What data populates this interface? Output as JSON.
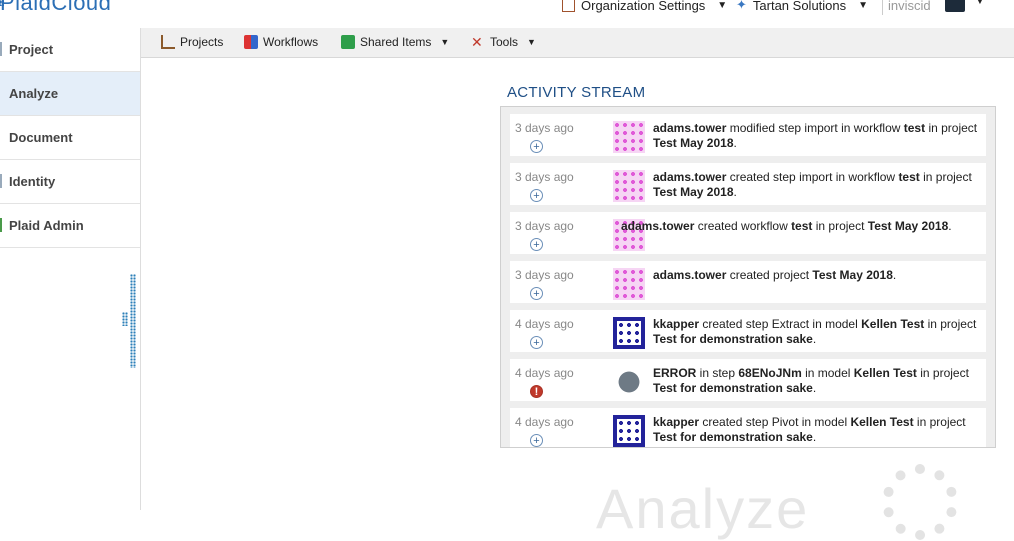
{
  "app": {
    "logo_text": "PlaidCloud"
  },
  "topnav": {
    "org_settings": "Organization Settings",
    "tartan": "Tartan Solutions",
    "user": "inviscid"
  },
  "sidebar": {
    "items": [
      {
        "label": "Project",
        "active": false
      },
      {
        "label": "Analyze",
        "active": true
      },
      {
        "label": "Document",
        "active": false
      },
      {
        "label": "Identity",
        "active": false
      },
      {
        "label": "Plaid Admin",
        "active": false
      }
    ]
  },
  "toolbar": {
    "projects": "Projects",
    "workflows": "Workflows",
    "shared_items": "Shared Items",
    "tools": "Tools"
  },
  "stream": {
    "title": "ACTIVITY STREAM",
    "entries": [
      {
        "time": "3 days ago",
        "icon": "plus-circle-icon"
      },
      {
        "time": "3 days ago",
        "icon": "plus-circle-icon"
      },
      {
        "time": "3 days ago",
        "icon": "plus-circle-icon"
      },
      {
        "time": "3 days ago",
        "icon": "plus-circle-icon"
      },
      {
        "time": "4 days ago",
        "icon": "plus-circle-icon"
      },
      {
        "time": "4 days ago",
        "icon": "error-icon"
      },
      {
        "time": "4 days ago",
        "icon": "plus-circle-icon"
      }
    ],
    "e0": {
      "user": "adams.tower",
      "t1": " modified step import in workflow ",
      "b1": "test",
      "t2": " in project ",
      "b2": "Test May 2018",
      "t3": "."
    },
    "e1": {
      "user": "adams.tower",
      "t1": " created step import in workflow ",
      "b1": "test",
      "t2": " in project ",
      "b2": "Test May 2018",
      "t3": "."
    },
    "e2": {
      "user": "adams.tower",
      "t1": " created workflow ",
      "b1": "test",
      "t2": " in project ",
      "b2": "Test May 2018",
      "t3": "."
    },
    "e3": {
      "user": "adams.tower",
      "t1": " created project ",
      "b2": "Test May 2018",
      "t3": "."
    },
    "e4": {
      "user": "kkapper",
      "t1": " created step Extract in model ",
      "b1": "Kellen Test",
      "t2": " in project ",
      "b2": "Test for demonstration sake",
      "t3": "."
    },
    "e5": {
      "user": "ERROR",
      "t1": " in step ",
      "b1": "68ENoJNm",
      "t2": " in model ",
      "b2": "Kellen Test",
      "t3": " in project ",
      "b3": "Test for demonstration sake",
      "t4": "."
    },
    "e6": {
      "user": "kkapper",
      "t1": " created step Pivot in model ",
      "b1": "Kellen Test",
      "t2": " in project ",
      "b2": "Test for demonstration sake",
      "t3": "."
    }
  },
  "watermark": {
    "text": "Analyze"
  }
}
